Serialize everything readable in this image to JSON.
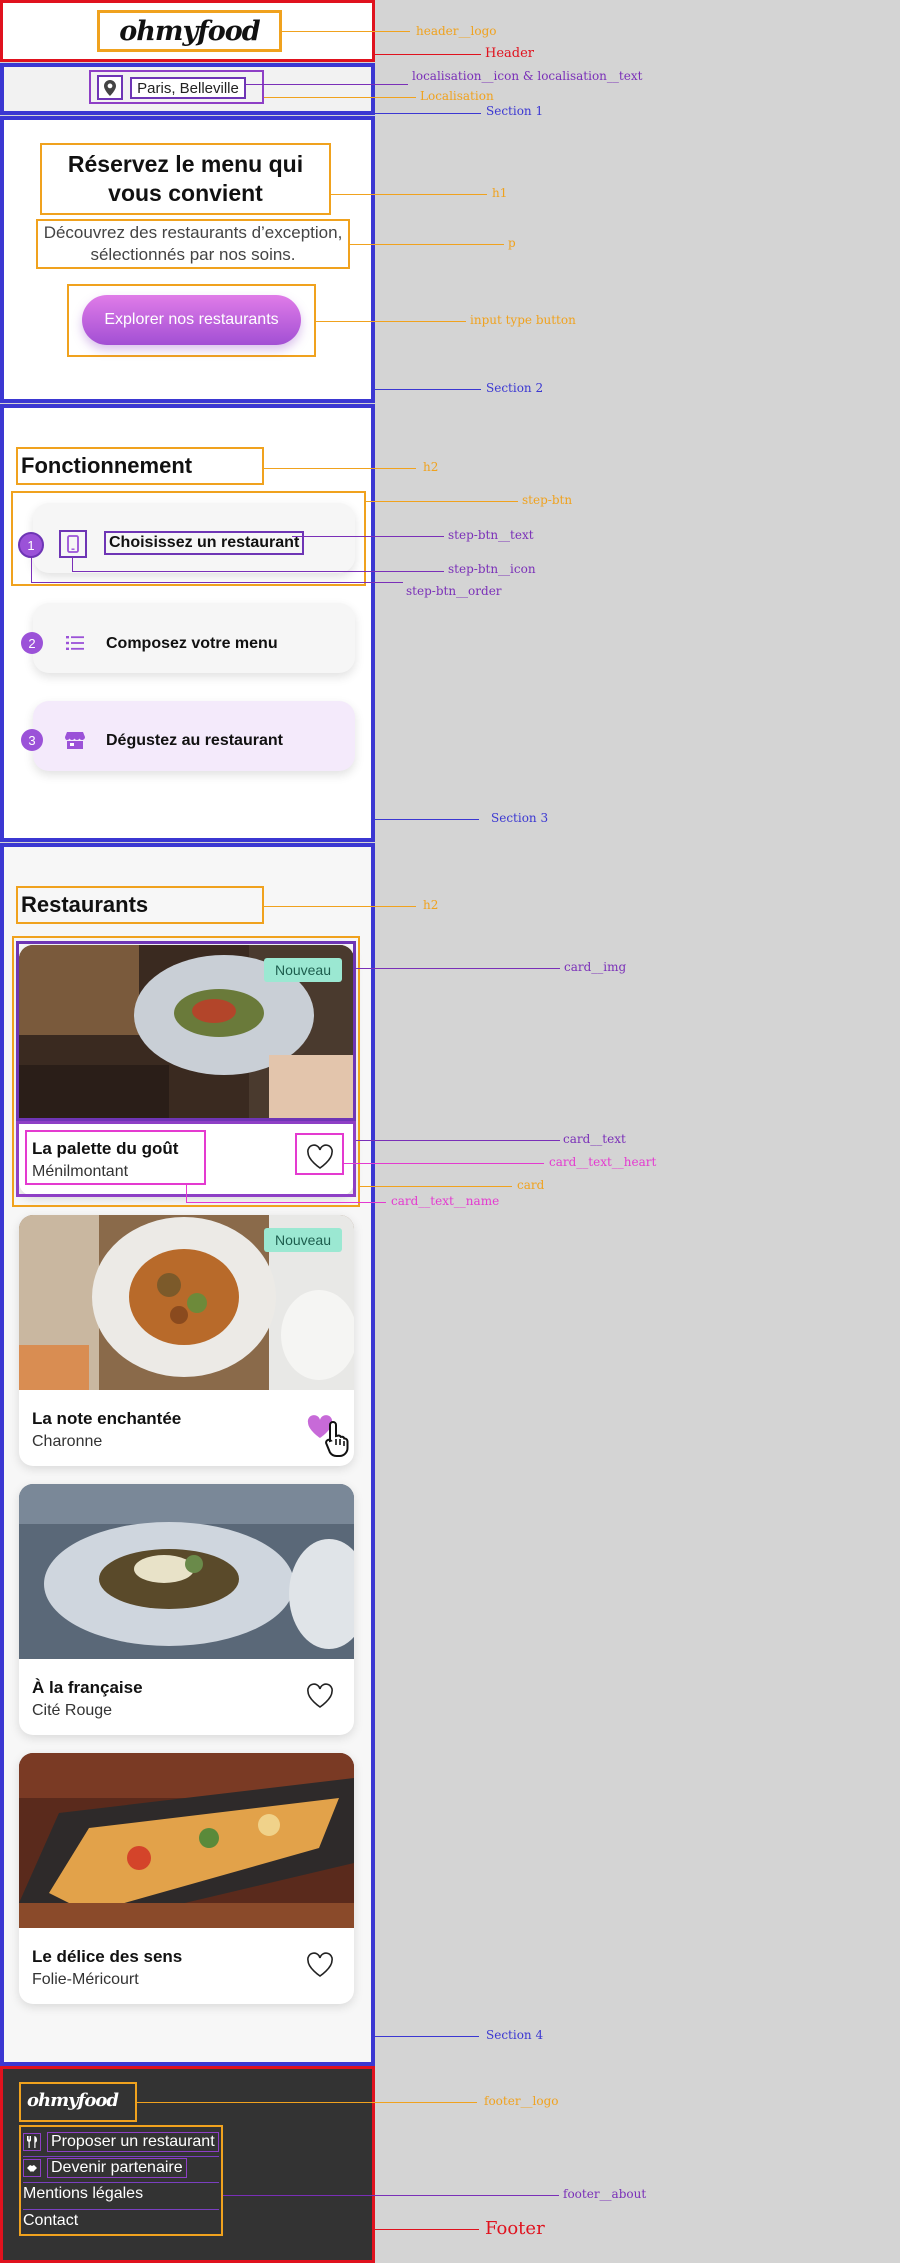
{
  "header": {
    "logo": "ohmyfood"
  },
  "localisation": {
    "text": "Paris, Belleville",
    "icon": "map-pin-icon"
  },
  "hero": {
    "title": "Réservez le menu qui vous convient",
    "subtitle": "Découvrez des restaurants d’exception, sélectionnés par nos soins.",
    "button": "Explorer nos restaurants"
  },
  "how": {
    "title": "Fonctionnement",
    "steps": [
      {
        "order": "1",
        "icon": "mobile-icon",
        "label": "Choisissez un restaurant"
      },
      {
        "order": "2",
        "icon": "list-icon",
        "label": "Composez votre menu"
      },
      {
        "order": "3",
        "icon": "store-icon",
        "label": "Dégustez au restaurant"
      }
    ]
  },
  "restaurants": {
    "title": "Restaurants",
    "cards": [
      {
        "name": "La palette du goût",
        "area": "Ménilmontant",
        "badge": "Nouveau",
        "liked": false
      },
      {
        "name": "La note enchantée",
        "area": "Charonne",
        "badge": "Nouveau",
        "liked": true
      },
      {
        "name": "À la française",
        "area": "Cité Rouge",
        "badge": "",
        "liked": false
      },
      {
        "name": "Le délice des sens",
        "area": "Folie-Méricourt",
        "badge": "",
        "liked": false
      }
    ]
  },
  "footer": {
    "logo": "ohmyfood",
    "links": [
      "Proposer un restaurant",
      "Devenir partenaire",
      "Mentions légales",
      "Contact"
    ]
  },
  "annotations": {
    "header_logo": "header__logo",
    "header": "Header",
    "localisation_icon_text": "localisation__icon & localisation__text",
    "localisation": "Localisation",
    "section1": "Section 1",
    "h1": "h1",
    "p": "p",
    "input_button": "input type button",
    "section2": "Section 2",
    "h2_a": "h2",
    "step_btn": "step-btn",
    "step_btn_text": "step-btn__text",
    "step_btn_icon": "step-btn__icon",
    "step_btn_order": "step-btn__order",
    "section3": "Section 3",
    "h2_b": "h2",
    "card_img": "card__img",
    "card_text": "card__text",
    "card_text_heart": "card__text__heart",
    "card": "card",
    "card_text_name": "card__text__name",
    "section4": "Section 4",
    "footer_logo": "footer__logo",
    "footer_about": "footer__about",
    "footer": "Footer"
  },
  "colors": {
    "accent_purple": "#9b52d8",
    "gradient_pink": "#e07ce8",
    "badge_mint": "#9be8d2",
    "frame_orange": "#f0a21e",
    "frame_purple": "#7a2fb8",
    "frame_pink": "#e43ad0",
    "section_blue": "#3b37d2",
    "header_red": "#e0121e"
  }
}
